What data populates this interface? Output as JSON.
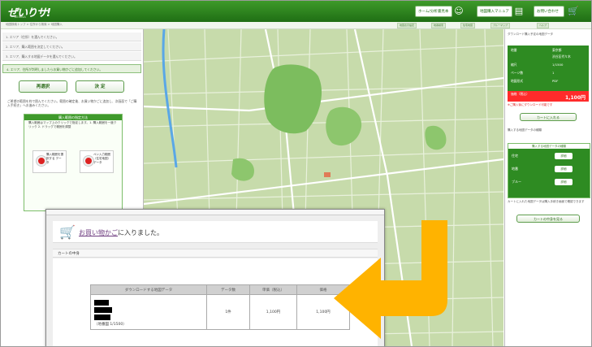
{
  "header": {
    "logo": "ぜいりサ!",
    "logo_sub": "ZEIRISA",
    "buttons": [
      {
        "label": "ホーム/分析書見本"
      },
      {
        "label": "地図購入マニュアル"
      },
      {
        "label": "お問い合わせ"
      }
    ]
  },
  "subbar": {
    "breadcrumb": "地図検索トップ > 住所から検索 > 地図購入",
    "links": [
      "地図表示設定",
      "地番検索",
      "住宅地図",
      "ブルーマップ",
      "ヘルプ"
    ]
  },
  "left": {
    "steps": [
      "1. エリア（住所）を選んでください。",
      "2. エリア、購入範囲を決定してください。",
      "3. エリア、購入する地図データを選んでください。",
      "4. エリア、住所が判明しましたらお買い物かごに追加してください。"
    ],
    "buttons": {
      "left": "再選択",
      "right": "決 定"
    },
    "note": "ご希望の範囲を枠で囲んでください。範囲の確定後、お買い物かごに追加し、次画面で「ご購入手続き」へお進みください。",
    "info": {
      "title": "購入範囲の指定方法",
      "text": "購入範囲はマップ上のクリックで指定します。1. 購入範囲を一度クリック 2. ドラッグで範囲を調整",
      "button_a": "購入範囲を選択する データ",
      "button_b": "ペン入力範囲（住宅地図）データ"
    }
  },
  "right": {
    "head": "ダウンロード購入予定の地図データ",
    "rows": [
      {
        "label": "地番",
        "value": "東京都"
      },
      {
        "label": "",
        "value": "渋谷区代々木"
      },
      {
        "label": "縮尺",
        "value": "1/1500"
      },
      {
        "label": "ページ数",
        "value": "1"
      },
      {
        "label": "地図形式",
        "value": "PDF"
      }
    ],
    "price_label": "価格（税込）",
    "price": "1,100円",
    "price_note": "※ご購入後にダウンロード可能です",
    "cart_button": "カートに入れる",
    "box_title": "購入する地図データの種類",
    "box_rows": [
      "住宅",
      "地番",
      "ブルー"
    ],
    "box_button": "詳細",
    "footer_note": "カートに入れた地図データは購入手続き画面で確認できます",
    "footer_button": "カートの中身を見る"
  },
  "popup": {
    "title_link": "お買い物かご",
    "title_rest": "に入りました。",
    "subtitle": "カートの中身",
    "table": {
      "headers": [
        "ダウンロードする地図データ",
        "データ数",
        "単価（税込）",
        "価格"
      ],
      "row": {
        "name_suffix": "（地番図 1/1500）",
        "qty": "1件",
        "unit": "1,100円",
        "price": "1,100円"
      }
    }
  },
  "colors": {
    "header_green": "#2e8b22",
    "price_red": "#ff2b2b",
    "arrow": "#ffb300"
  },
  "icons": {
    "cart": "cart-icon",
    "manual": "book-icon",
    "contact": "mail-icon",
    "arrow": "return-arrow-icon"
  }
}
